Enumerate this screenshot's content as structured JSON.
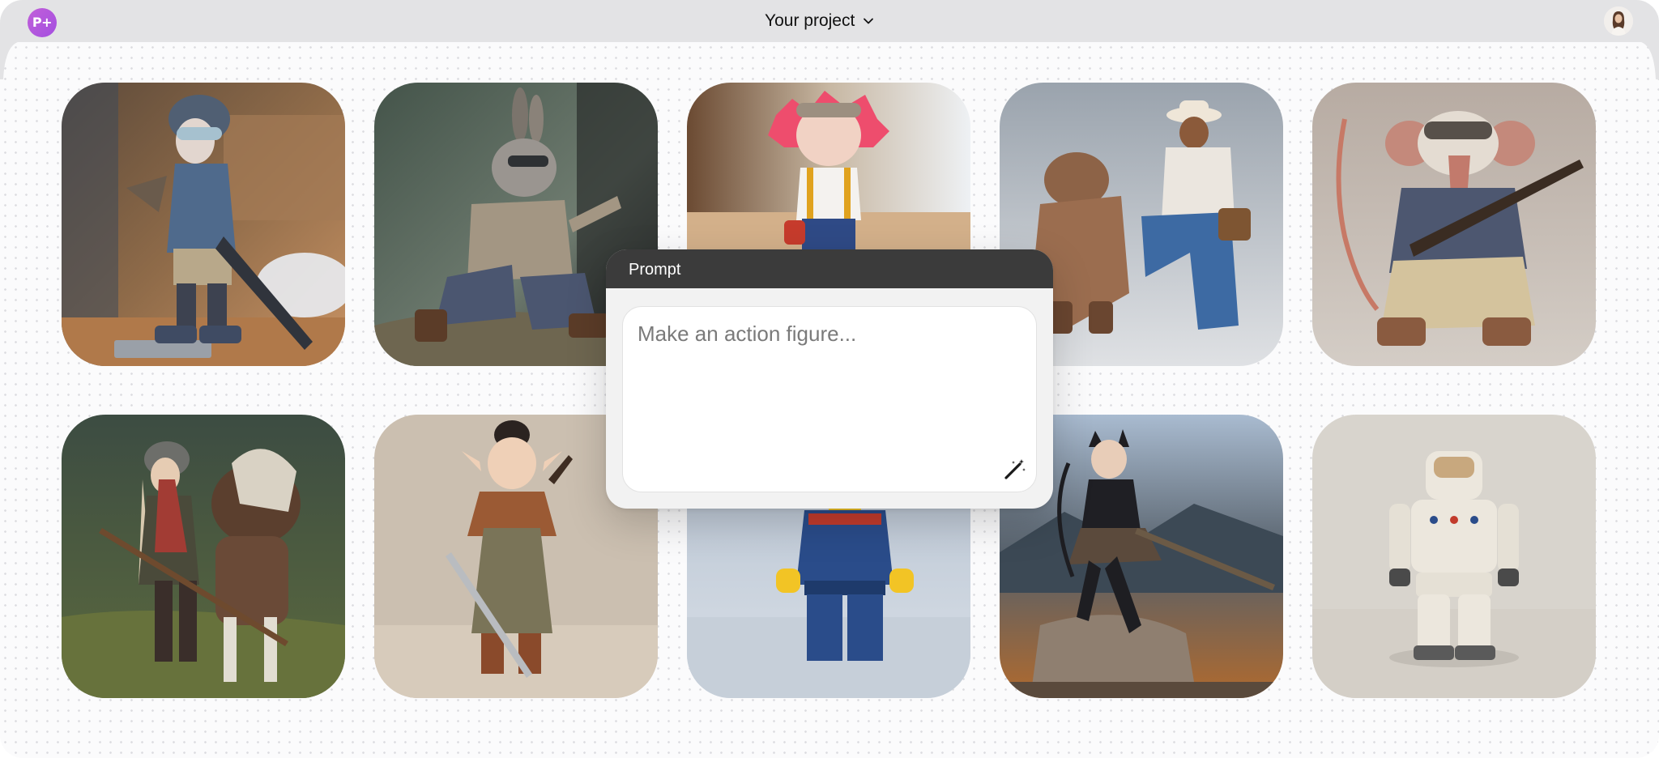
{
  "app": {
    "logo_text": "P+",
    "logo_color": "#b458dd"
  },
  "header": {
    "project_name": "Your project",
    "project_menu_icon": "chevron-down-icon",
    "avatar_icon": "user-avatar"
  },
  "gallery": {
    "images": [
      {
        "subject": "anime girl with goggles holding a rifle"
      },
      {
        "subject": "rabbit in jacket running"
      },
      {
        "subject": "pink-haired figure with goggles"
      },
      {
        "subject": "bear fighting a cowboy"
      },
      {
        "subject": "rat with goggles holding a rifle"
      },
      {
        "subject": "woman with horse and spear"
      },
      {
        "subject": "elf warrior with sword"
      },
      {
        "subject": "brick minifigure in blue uniform"
      },
      {
        "subject": "cat girl with sword on rock"
      },
      {
        "subject": "astronaut figure in white suit"
      }
    ]
  },
  "prompt": {
    "title": "Prompt",
    "placeholder": "Make an action figure...",
    "value": "",
    "generate_icon": "magic-wand-icon"
  }
}
